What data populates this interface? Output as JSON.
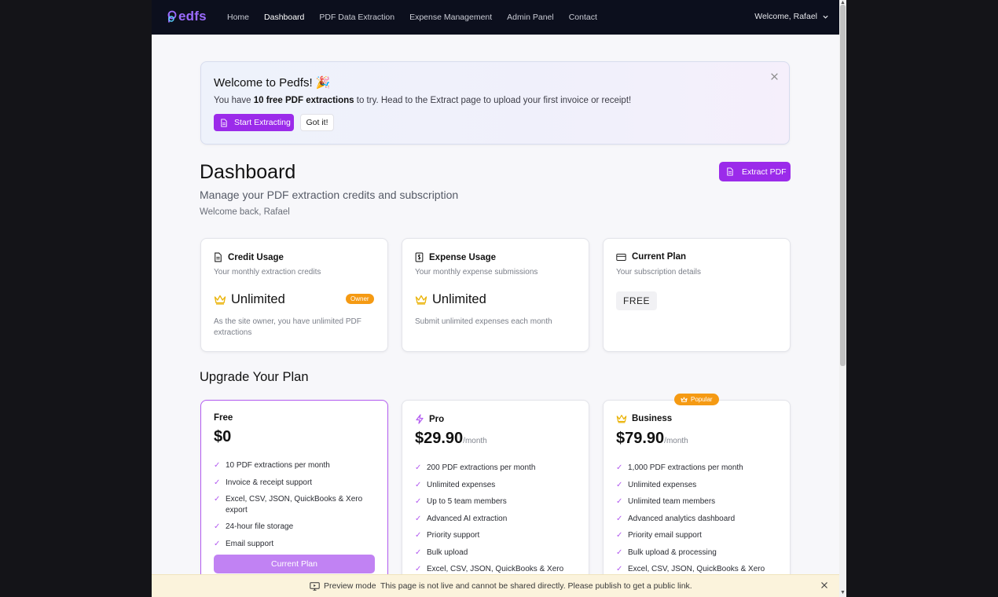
{
  "nav": {
    "logo": "edfs",
    "links": [
      "Home",
      "Dashboard",
      "PDF Data Extraction",
      "Expense Management",
      "Admin Panel",
      "Contact"
    ],
    "active": "Dashboard",
    "welcome": "Welcome, Rafael"
  },
  "banner": {
    "title": "Welcome to Pedfs! 🎉",
    "text_pre": "You have ",
    "text_bold": "10 free PDF extractions",
    "text_post": " to try. Head to the Extract page to upload your first invoice or receipt!",
    "start_label": "Start Extracting",
    "got_label": "Got it!"
  },
  "dashboard": {
    "title": "Dashboard",
    "subtitle": "Manage your PDF extraction credits and subscription",
    "welcome": "Welcome back, Rafael",
    "extract_label": "Extract PDF"
  },
  "cards": {
    "credit": {
      "title": "Credit Usage",
      "desc": "Your monthly extraction credits",
      "value": "Unlimited",
      "badge": "Owner",
      "foot": "As the site owner, you have unlimited PDF extractions"
    },
    "expense": {
      "title": "Expense Usage",
      "desc": "Your monthly expense submissions",
      "value": "Unlimited",
      "foot": "Submit unlimited expenses each month"
    },
    "plan": {
      "title": "Current Plan",
      "desc": "Your subscription details",
      "value": "FREE"
    }
  },
  "upgrade": {
    "title": "Upgrade Your Plan",
    "popular": "Popular",
    "plans": [
      {
        "name": "Free",
        "price": "$0",
        "per": "",
        "features": [
          "10 PDF extractions per month",
          "Invoice & receipt support",
          "Excel, CSV, JSON, QuickBooks & Xero export",
          "24-hour file storage",
          "Email support"
        ],
        "button": "Current Plan"
      },
      {
        "name": "Pro",
        "price": "$29.90",
        "per": "/month",
        "features": [
          "200 PDF extractions per month",
          "Unlimited expenses",
          "Up to 5 team members",
          "Advanced AI extraction",
          "Priority support",
          "Bulk upload",
          "Excel, CSV, JSON, QuickBooks & Xero"
        ]
      },
      {
        "name": "Business",
        "price": "$79.90",
        "per": "/month",
        "features": [
          "1,000 PDF extractions per month",
          "Unlimited expenses",
          "Unlimited team members",
          "Advanced analytics dashboard",
          "Priority email support",
          "Bulk upload & processing",
          "Excel, CSV, JSON, QuickBooks & Xero"
        ]
      }
    ]
  },
  "preview": {
    "mode": "Preview mode",
    "text": "This page is not live and cannot be shared directly. Please publish to get a public link."
  },
  "colors": {
    "accent": "#9b2bea",
    "nav_bg": "#0c0f1d",
    "badge": "#f59a13"
  },
  "icons": {
    "logo": "p-logo-icon",
    "doc": "document-icon",
    "dollar": "dollar-doc-icon",
    "card": "credit-card-icon",
    "crown": "crown-icon",
    "bolt": "bolt-icon",
    "close": "close-icon",
    "chevron": "chevron-down-icon",
    "monitor": "monitor-icon"
  }
}
